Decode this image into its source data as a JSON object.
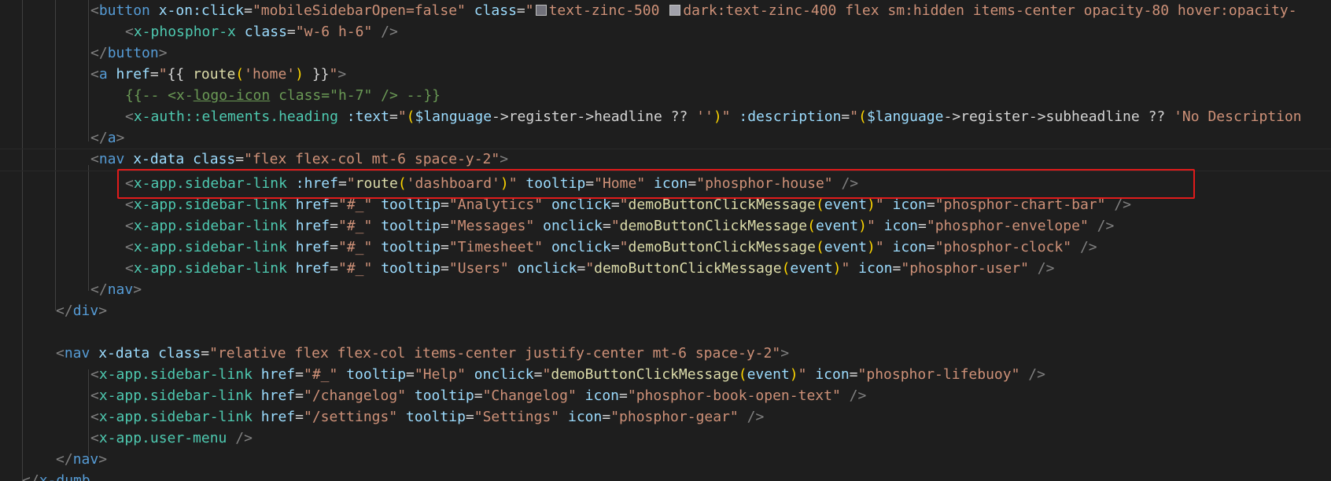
{
  "editor": {
    "lines": {
      "l1": {
        "tag": "button",
        "attr1": "x-on:click",
        "val1": "mobileSidebarOpen=false",
        "attr2": "class",
        "val2a": "text-zinc-500",
        "val2b": "dark:text-zinc-400 flex sm:hidden items-center opacity-80 hover:opacity-"
      },
      "l2": {
        "tag": "x-phosphor-x",
        "attr": "class",
        "val": "w-6 h-6"
      },
      "l3": {
        "tag": "button"
      },
      "l4": {
        "tag": "a",
        "attr": "href",
        "val_pre": "{{ ",
        "func": "route",
        "arg": "'home'",
        "val_post": " }}"
      },
      "l5": {
        "comment_pre": "{{-- <x-",
        "comment_under": "logo-icon",
        "comment_post": " class=\"h-7\" /> --}}"
      },
      "l6": {
        "tag": "x-auth::elements.heading",
        "attr1": ":text",
        "val1_pre": "(",
        "val1_var": "$language",
        "val1_mid": "->register->headline ?? ",
        "val1_str": "''",
        "val1_post": ")",
        "attr2": ":description",
        "val2_pre": "(",
        "val2_var": "$language",
        "val2_mid": "->register->subheadline ?? ",
        "val2_str": "'No Description"
      },
      "l7": {
        "tag": "a"
      },
      "l8": {
        "tag": "nav",
        "attr1": "x-data",
        "attr2": "class",
        "val2": "flex flex-col mt-6 space-y-2"
      },
      "l9": {
        "tag": "x-app.sidebar-link",
        "attr1": ":href",
        "func": "route",
        "arg": "'dashboard'",
        "attr2": "tooltip",
        "val2": "Home",
        "attr3": "icon",
        "val3": "phosphor-house"
      },
      "l10": {
        "tag": "x-app.sidebar-link",
        "attr1": "href",
        "val1": "#_",
        "attr2": "tooltip",
        "val2": "Analytics",
        "attr3": "onclick",
        "val3_func": "demoButtonClickMessage",
        "val3_arg": "event",
        "attr4": "icon",
        "val4": "phosphor-chart-bar"
      },
      "l11": {
        "tag": "x-app.sidebar-link",
        "attr1": "href",
        "val1": "#_",
        "attr2": "tooltip",
        "val2": "Messages",
        "attr3": "onclick",
        "val3_func": "demoButtonClickMessage",
        "val3_arg": "event",
        "attr4": "icon",
        "val4": "phosphor-envelope"
      },
      "l12": {
        "tag": "x-app.sidebar-link",
        "attr1": "href",
        "val1": "#_",
        "attr2": "tooltip",
        "val2": "Timesheet",
        "attr3": "onclick",
        "val3_func": "demoButtonClickMessage",
        "val3_arg": "event",
        "attr4": "icon",
        "val4": "phosphor-clock"
      },
      "l13": {
        "tag": "x-app.sidebar-link",
        "attr1": "href",
        "val1": "#_",
        "attr2": "tooltip",
        "val2": "Users",
        "attr3": "onclick",
        "val3_func": "demoButtonClickMessage",
        "val3_arg": "event",
        "attr4": "icon",
        "val4": "phosphor-user"
      },
      "l14": {
        "tag": "nav"
      },
      "l15": {
        "tag": "div"
      },
      "l17": {
        "tag": "nav",
        "attr1": "x-data",
        "attr2": "class",
        "val2": "relative flex flex-col items-center justify-center mt-6 space-y-2"
      },
      "l18": {
        "tag": "x-app.sidebar-link",
        "attr1": "href",
        "val1": "#_",
        "attr2": "tooltip",
        "val2": "Help",
        "attr3": "onclick",
        "val3_func": "demoButtonClickMessage",
        "val3_arg": "event",
        "attr4": "icon",
        "val4": "phosphor-lifebuoy"
      },
      "l19": {
        "tag": "x-app.sidebar-link",
        "attr1": "href",
        "val1": "/changelog",
        "attr2": "tooltip",
        "val2": "Changelog",
        "attr3": "icon",
        "val3": "phosphor-book-open-text"
      },
      "l20": {
        "tag": "x-app.sidebar-link",
        "attr1": "href",
        "val1": "/settings",
        "attr2": "tooltip",
        "val2": "Settings",
        "attr3": "icon",
        "val3": "phosphor-gear"
      },
      "l21": {
        "tag": "x-app.user-menu"
      },
      "l22": {
        "tag": "nav"
      },
      "l23": {
        "tag": "x-dumb"
      }
    }
  }
}
